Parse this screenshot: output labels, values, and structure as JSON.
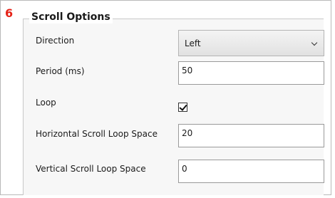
{
  "step": {
    "number": "6"
  },
  "section": {
    "title": "Scroll Options"
  },
  "fields": {
    "direction": {
      "label": "Direction",
      "value": "Left"
    },
    "period": {
      "label": "Period (ms)",
      "value": "50"
    },
    "loop": {
      "label": "Loop",
      "checked": true
    },
    "horizontal_space": {
      "label": "Horizontal Scroll Loop Space",
      "value": "20"
    },
    "vertical_space": {
      "label": "Vertical Scroll Loop Space",
      "value": "0"
    }
  },
  "icons": {
    "dropdown": "chevron-down-icon",
    "check": "checkmark-icon"
  }
}
